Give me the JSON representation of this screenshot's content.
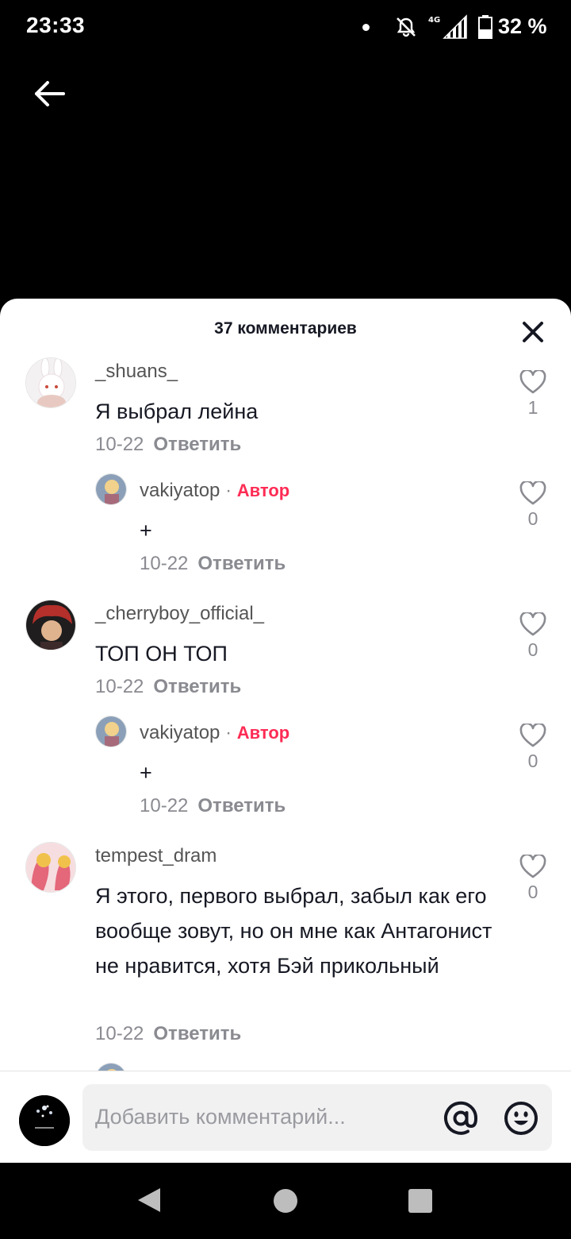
{
  "status_bar": {
    "time": "23:33",
    "network": "4G",
    "battery": "32 %"
  },
  "sheet": {
    "title": "37 комментариев"
  },
  "comments": [
    {
      "username": "_shuans_",
      "text": "Я выбрал лейна",
      "date": "10-22",
      "reply_label": "Ответить",
      "likes": "1",
      "avatar_colors": [
        "#f4f1f3",
        "#e8c9c1",
        "#c94a3a"
      ],
      "replies": [
        {
          "username": "vakiyatop",
          "badge": "Автор",
          "text": "+",
          "date": "10-22",
          "reply_label": "Ответить",
          "likes": "0"
        }
      ]
    },
    {
      "username": "_cherryboy_official_",
      "text": "ТОП ОН ТОП",
      "date": "10-22",
      "reply_label": "Ответить",
      "likes": "0",
      "avatar_colors": [
        "#b5302b",
        "#1f1d1d",
        "#e0b38f"
      ],
      "replies": [
        {
          "username": "vakiyatop",
          "badge": "Автор",
          "text": "+",
          "date": "10-22",
          "reply_label": "Ответить",
          "likes": "0"
        }
      ]
    },
    {
      "username": "tempest_dram",
      "text": "Я этого, первого выбрал, забыл как его вообще зовут, но он мне как Антагонист не нравится, хотя Бэй прикольный",
      "date": "10-22",
      "reply_label": "Ответить",
      "likes": "0",
      "avatar_colors": [
        "#f6dde0",
        "#e4677a",
        "#f0c24b"
      ]
    }
  ],
  "input": {
    "placeholder": "Добавить комментарий..."
  },
  "colors": {
    "accent": "#fe2c55",
    "muted": "#8a8b91",
    "text": "#161823"
  },
  "icons": [
    "back-arrow-icon",
    "close-icon",
    "heart-icon",
    "at-icon",
    "emoji-icon",
    "bell-off-icon",
    "signal-icon",
    "battery-icon"
  ]
}
